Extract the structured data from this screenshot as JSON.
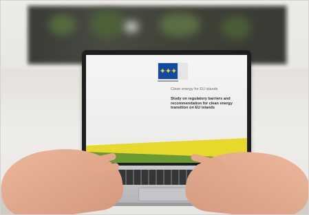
{
  "screen": {
    "subtitle": "Clean energy for EU islands",
    "title": "Study on regulatory barriers and recommendation for clean energy transition on EU islands"
  },
  "colors": {
    "eu_blue": "#114a9e",
    "eu_yellow": "#f2d22e",
    "banner_yellow": "#e6d92b",
    "banner_green": "#6a9a34"
  },
  "icons": {
    "logo": "eu-flag-icon"
  }
}
